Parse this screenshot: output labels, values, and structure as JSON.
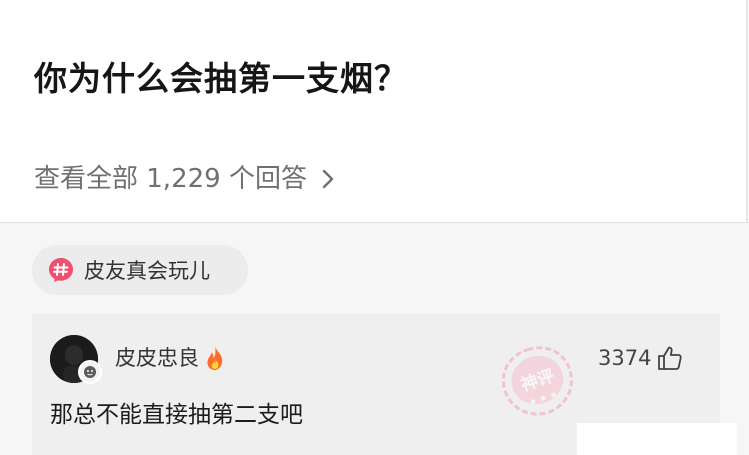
{
  "question": {
    "title": "你为什么会抽第一支烟？",
    "view_all_label": "查看全部 1,229 个回答"
  },
  "topic_tag": {
    "label": "皮友真会玩儿",
    "icon": "hash-icon",
    "color": "#f0506e"
  },
  "comment": {
    "username": "皮皮忠良",
    "user_badge_icon": "fire-icon",
    "like_count": "3374",
    "text": "那总不能直接抽第二支吧",
    "stamp_label": "神评"
  },
  "colors": {
    "accent": "#f0506e",
    "stamp": "#f2a0b4",
    "fire": "#ff6a2b"
  }
}
